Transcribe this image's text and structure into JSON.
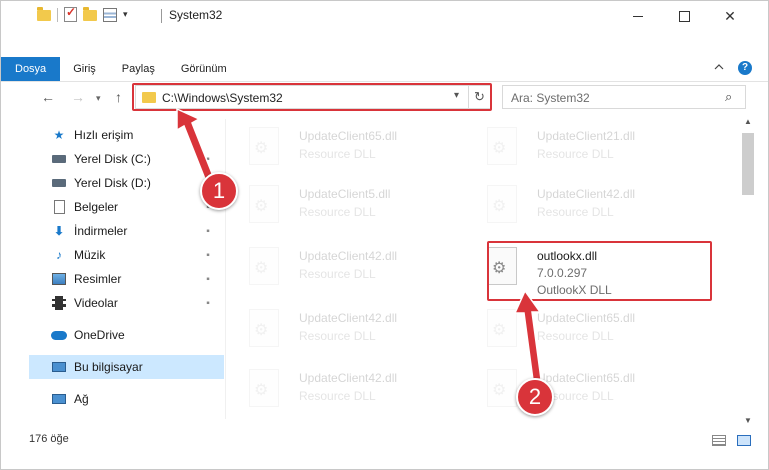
{
  "window": {
    "title": "System32",
    "controls": {
      "minimize": "",
      "maximize": "",
      "close": "✕"
    }
  },
  "quick_access_toolbar": {
    "dropdown": "▾"
  },
  "ribbon": {
    "tabs": [
      {
        "label": "Dosya",
        "active": true
      },
      {
        "label": "Giriş",
        "active": false
      },
      {
        "label": "Paylaş",
        "active": false
      },
      {
        "label": "Görünüm",
        "active": false
      }
    ],
    "help": "?"
  },
  "navigation": {
    "back": "←",
    "forward": "→",
    "recent": "▾",
    "up": "↑",
    "address": "C:\\Windows\\System32",
    "address_dropdown": "▾",
    "refresh": "↻",
    "search_placeholder": "Ara: System32",
    "search_icon": "⌕"
  },
  "sidebar": {
    "items": [
      {
        "label": "Hızlı erişim",
        "icon": "star-icon",
        "pinned": false
      },
      {
        "label": "Yerel Disk (C:)",
        "icon": "drive-icon",
        "pinned": true
      },
      {
        "label": "Yerel Disk (D:)",
        "icon": "drive-icon",
        "pinned": true
      },
      {
        "label": "Belgeler",
        "icon": "document-icon",
        "pinned": true
      },
      {
        "label": "İndirmeler",
        "icon": "download-icon",
        "pinned": true
      },
      {
        "label": "Müzik",
        "icon": "music-icon",
        "pinned": true
      },
      {
        "label": "Resimler",
        "icon": "pictures-icon",
        "pinned": true
      },
      {
        "label": "Videolar",
        "icon": "video-icon",
        "pinned": true
      },
      {
        "label": "OneDrive",
        "icon": "cloud-icon",
        "pinned": false
      },
      {
        "label": "Bu bilgisayar",
        "icon": "computer-icon",
        "pinned": false,
        "selected": true
      },
      {
        "label": "Ağ",
        "icon": "network-icon",
        "pinned": false
      }
    ],
    "pin_glyph": "📌"
  },
  "files": [
    {
      "name": "UpdateClient65.dll",
      "desc": "Resource DLL"
    },
    {
      "name": "UpdateClient21.dll",
      "desc": "Resource DLL"
    },
    {
      "name": "UpdateClient5.dll",
      "desc": "Resource DLL"
    },
    {
      "name": "UpdateClient42.dll",
      "desc": "Resource DLL"
    },
    {
      "name": "UpdateClient42.dll",
      "desc": "Resource DLL"
    },
    {
      "name": "outlookx.dll",
      "version": "7.0.0.297",
      "desc": "OutlookX DLL",
      "highlighted": true
    },
    {
      "name": "UpdateClient42.dll",
      "desc": "Resource DLL"
    },
    {
      "name": "UpdateClient65.dll",
      "desc": "Resource DLL"
    },
    {
      "name": "UpdateClient42.dll",
      "desc": "Resource DLL"
    },
    {
      "name": "UpdateClient65.dll",
      "desc": "Resource DLL"
    }
  ],
  "status": {
    "item_count": "176 öğe"
  },
  "annotations": {
    "step1": "1",
    "step2": "2",
    "color": "#d9343a"
  },
  "colors": {
    "accent": "#1979ca",
    "selection": "#cce8ff",
    "highlight": "#d9343a"
  }
}
